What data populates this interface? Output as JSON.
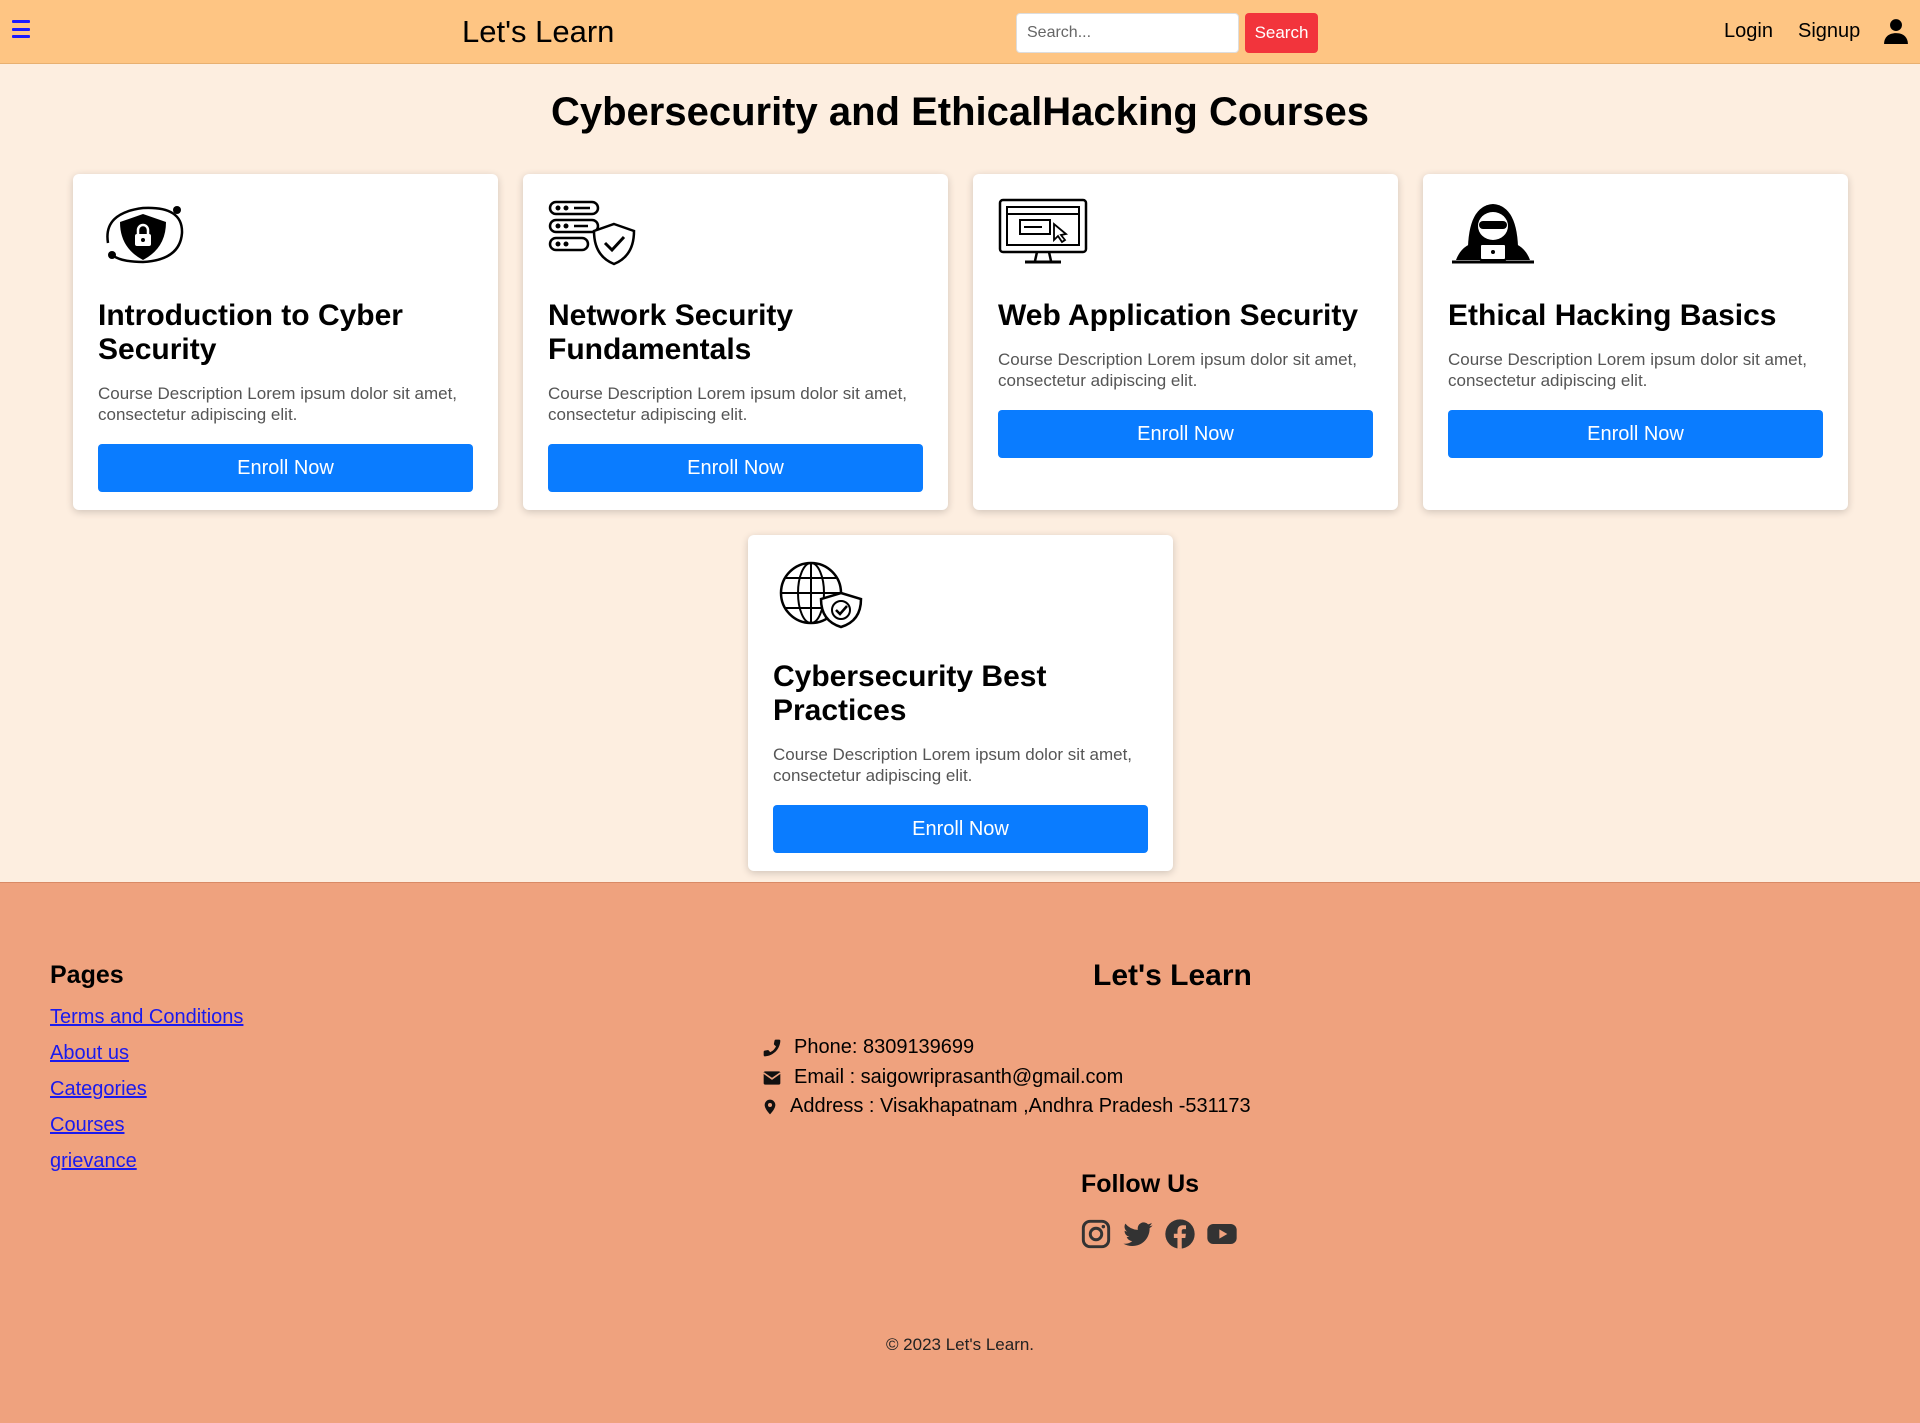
{
  "header": {
    "brand": "Let's Learn",
    "search_placeholder": "Search...",
    "search_button": "Search",
    "login": "Login",
    "signup": "Signup"
  },
  "page_title": "Cybersecurity and EthicalHacking Courses",
  "courses": [
    {
      "title": "Introduction to Cyber Security",
      "description": "Course Description Lorem ipsum dolor sit amet, consectetur adipiscing elit.",
      "button": "Enroll Now",
      "icon": "shield-lock-icon"
    },
    {
      "title": "Network Security Fundamentals",
      "description": "Course Description Lorem ipsum dolor sit amet, consectetur adipiscing elit.",
      "button": "Enroll Now",
      "icon": "server-shield-icon"
    },
    {
      "title": "Web Application Security",
      "description": "Course Description Lorem ipsum dolor sit amet, consectetur adipiscing elit.",
      "button": "Enroll Now",
      "icon": "monitor-web-icon"
    },
    {
      "title": "Ethical Hacking Basics",
      "description": "Course Description Lorem ipsum dolor sit amet, consectetur adipiscing elit.",
      "button": "Enroll Now",
      "icon": "hacker-icon"
    },
    {
      "title": "Cybersecurity Best Practices",
      "description": "Course Description Lorem ipsum dolor sit amet, consectetur adipiscing elit.",
      "button": "Enroll Now",
      "icon": "globe-shield-icon"
    }
  ],
  "footer": {
    "pages_title": "Pages",
    "links": [
      "Terms and Conditions",
      "About us",
      "Categories",
      "Courses",
      "grievance"
    ],
    "brand": "Let's Learn",
    "phone": "Phone: 8309139699",
    "email": "Email : saigowriprasanth@gmail.com",
    "address": "Address : Visakhapatnam ,Andhra Pradesh -531173",
    "follow_title": "Follow Us",
    "social_icons": [
      "instagram-icon",
      "twitter-icon",
      "facebook-icon",
      "youtube-icon"
    ],
    "copyright": "© 2023 Let's Learn."
  },
  "colors": {
    "header_bg": "#fec583",
    "page_bg": "#fdeee0",
    "footer_bg": "#efa27e",
    "button_blue": "#0a7cff",
    "search_red": "#f2343c",
    "link_blue": "#1a1aee"
  }
}
